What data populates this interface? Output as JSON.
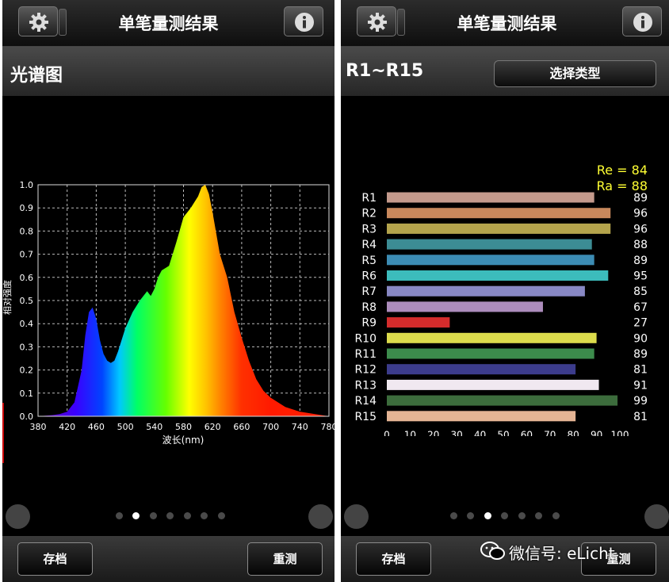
{
  "app": {
    "title": "单笔量测结果",
    "watermark": "微信号: eLicht"
  },
  "icons": [
    "gear-icon",
    "info-icon",
    "wechat-icon"
  ],
  "left_screen": {
    "subtitle": "光谱图",
    "buttons": {
      "save": "存档",
      "remeasure": "重测"
    },
    "page_dots": {
      "count": 7,
      "active": 1
    }
  },
  "right_screen": {
    "subtitle": "R1~R15",
    "select_button": "选择类型",
    "buttons": {
      "save": "存档",
      "remeasure": "重测"
    },
    "page_dots": {
      "count": 7,
      "active": 2
    }
  },
  "chart_data": [
    {
      "type": "area",
      "title": "",
      "xlabel": "波长(nm)",
      "ylabel": "相对强度",
      "xlim": [
        380,
        780
      ],
      "ylim": [
        0,
        1.0
      ],
      "grid": true,
      "x_ticks": [
        "380",
        "420",
        "460",
        "500",
        "540",
        "580",
        "620",
        "660",
        "700",
        "740",
        "780"
      ],
      "y_ticks": [
        "0.0",
        "0.1",
        "0.2",
        "0.3",
        "0.4",
        "0.5",
        "0.6",
        "0.7",
        "0.8",
        "0.9",
        "1.0"
      ],
      "x": [
        380,
        400,
        410,
        420,
        430,
        440,
        445,
        450,
        455,
        460,
        465,
        470,
        475,
        480,
        485,
        490,
        500,
        510,
        520,
        530,
        535,
        540,
        545,
        550,
        560,
        570,
        580,
        590,
        600,
        605,
        610,
        615,
        620,
        630,
        640,
        650,
        660,
        670,
        680,
        690,
        700,
        710,
        720,
        740,
        760,
        780
      ],
      "values": [
        0.0,
        0.005,
        0.01,
        0.02,
        0.06,
        0.2,
        0.35,
        0.45,
        0.47,
        0.42,
        0.33,
        0.27,
        0.24,
        0.23,
        0.24,
        0.28,
        0.38,
        0.45,
        0.5,
        0.54,
        0.52,
        0.55,
        0.6,
        0.63,
        0.65,
        0.75,
        0.86,
        0.9,
        0.95,
        0.99,
        1.0,
        0.96,
        0.88,
        0.7,
        0.6,
        0.45,
        0.34,
        0.24,
        0.16,
        0.11,
        0.08,
        0.06,
        0.04,
        0.02,
        0.01,
        0.0
      ]
    },
    {
      "type": "bar",
      "orientation": "horizontal",
      "title": "",
      "annotations": [
        "Re = 84",
        "Ra = 88"
      ],
      "xlim": [
        0,
        100
      ],
      "x_ticks": [
        "0",
        "10",
        "20",
        "30",
        "40",
        "50",
        "60",
        "70",
        "80",
        "90",
        "100"
      ],
      "categories": [
        "R1",
        "R2",
        "R3",
        "R4",
        "R5",
        "R6",
        "R7",
        "R8",
        "R9",
        "R10",
        "R11",
        "R12",
        "R13",
        "R14",
        "R15"
      ],
      "values": [
        89,
        96,
        96,
        88,
        89,
        95,
        85,
        67,
        27,
        90,
        89,
        81,
        91,
        99,
        81
      ],
      "value_labels": [
        "89",
        "96",
        "96",
        "88",
        "89",
        "95",
        "85",
        "67",
        "27",
        "90",
        "89",
        "81",
        "91",
        "99",
        "81"
      ],
      "colors": [
        "#c49a8c",
        "#c8885c",
        "#b4a44c",
        "#3c8c94",
        "#3c8cb4",
        "#3cbcbc",
        "#8888c4",
        "#ac8cbc",
        "#d42c2c",
        "#dcdc4c",
        "#3c8c4c",
        "#3c3c8c",
        "#f0e8f0",
        "#3c6c3c",
        "#e4b494"
      ]
    }
  ]
}
